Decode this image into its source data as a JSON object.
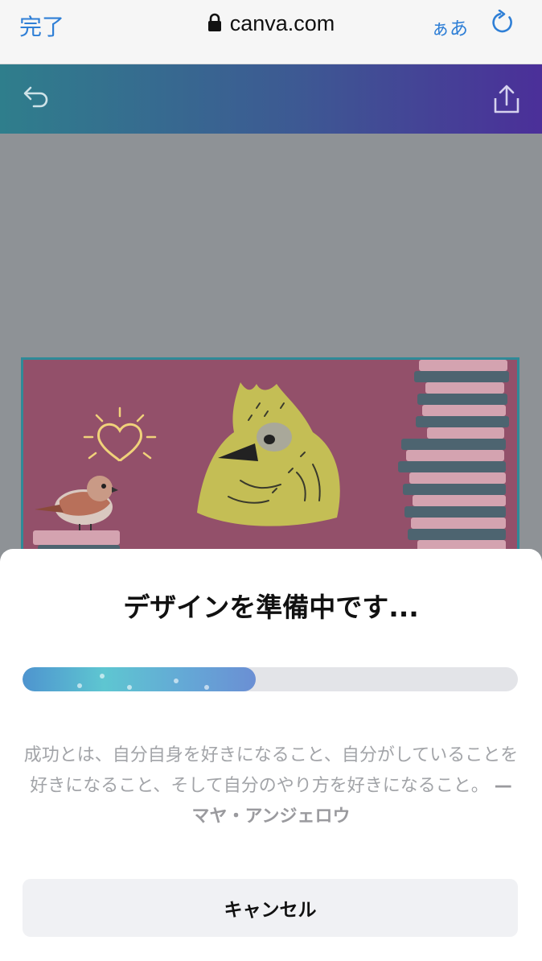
{
  "browser": {
    "done_label": "完了",
    "url": "canva.com",
    "text_size_label": "ぁあ",
    "lock_icon": "lock-icon",
    "reload_icon": "reload-icon"
  },
  "editor": {
    "undo_icon": "undo-icon",
    "share_icon": "share-icon"
  },
  "sheet": {
    "title": "デザインを準備中です...",
    "progress_percent": 47,
    "quote_text": "成功とは、自分自身を好きになること、自分がしていることを好きになること、そして自分のやり方を好きになること。",
    "quote_author": "— マヤ・アンジェロウ",
    "cancel_label": "キャンセル"
  },
  "colors": {
    "accent": "#2f7fd6",
    "editor_gradient_start": "#2f7e8c",
    "editor_gradient_end": "#4b2f99",
    "design_background": "#93506a",
    "progress_fill": "#5ec6d1"
  }
}
